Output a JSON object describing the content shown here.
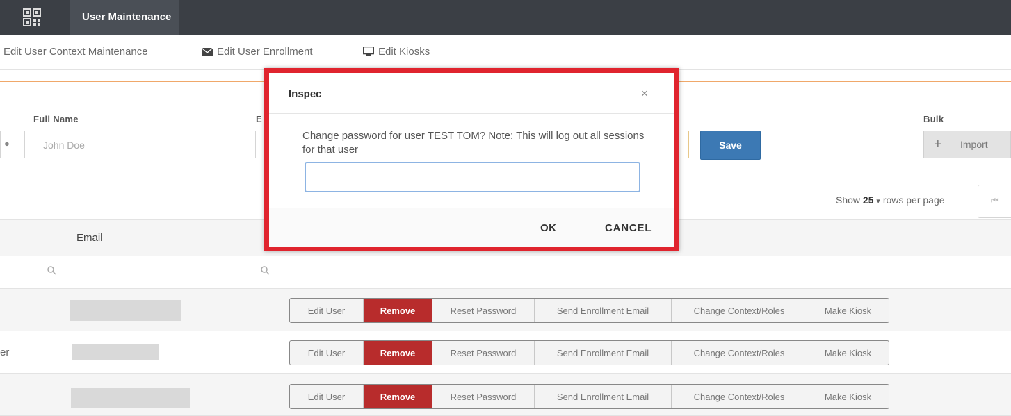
{
  "header": {
    "title": "User Maintenance",
    "app_icon": "qr-grid-icon"
  },
  "nav": {
    "items": [
      {
        "label": "Edit User Context Maintenance"
      },
      {
        "label": "Edit User Enrollment",
        "icon": "envelope-icon"
      },
      {
        "label": "Edit Kiosks",
        "icon": "monitor-icon"
      }
    ]
  },
  "form": {
    "full_name_label": "Full Name",
    "full_name_placeholder": "John Doe",
    "email_label_partial": "E",
    "save_label": "Save",
    "bulk_label": "Bulk",
    "bulk_plus": "+",
    "bulk_import": "Import"
  },
  "pagination": {
    "show": "Show",
    "rows": "25",
    "caret": "▾",
    "suffix": "rows per page",
    "first": "⏮"
  },
  "table": {
    "email_header": "Email",
    "row_partial_text": "er",
    "actions": [
      "Edit User",
      "Remove",
      "Reset Password",
      "Send Enrollment Email",
      "Change Context/Roles",
      "Make Kiosk"
    ]
  },
  "modal": {
    "title": "Inspec",
    "close": "×",
    "message": "Change password for user TEST TOM? Note: This will log out all sessions for that user",
    "input_value": "",
    "ok": "OK",
    "cancel": "CANCEL"
  },
  "colors": {
    "topbar": "#3b3f45",
    "save": "#3c79b4",
    "remove": "#b82c2c",
    "highlight": "#e0242e"
  }
}
